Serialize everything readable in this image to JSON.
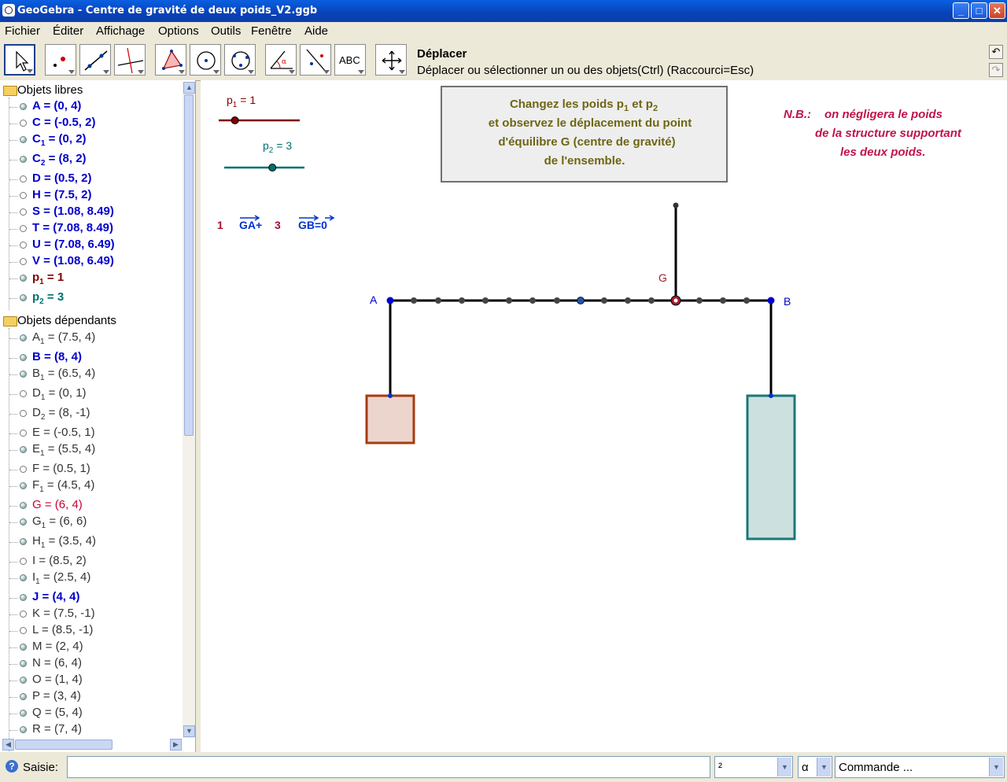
{
  "window": {
    "title": "GeoGebra - Centre de gravité de deux poids_V2.ggb",
    "min": "_",
    "max": "□",
    "close": "✕"
  },
  "menu": [
    "Fichier",
    "Éditer",
    "Affichage",
    "Options",
    "Outils",
    "Fenêtre",
    "Aide"
  ],
  "toolbar": {
    "tool_title": "Déplacer",
    "tool_help": "Déplacer ou sélectionner un ou des objets(Ctrl) (Raccourci=Esc)",
    "text_tool_label": "ABC",
    "undo": "↶",
    "redo": "↷"
  },
  "algebra": {
    "free_header": "Objets libres",
    "dependent_header": "Objets dépendants",
    "free": [
      {
        "name": "A",
        "value": "(0, 4)",
        "shown": true,
        "color": "#0000cc",
        "bold": true
      },
      {
        "name": "C",
        "value": "(-0.5, 2)",
        "shown": false,
        "color": "#0000cc",
        "bold": true
      },
      {
        "name": "C",
        "sub": "1",
        "value": "(0, 2)",
        "shown": true,
        "color": "#0000cc",
        "bold": true
      },
      {
        "name": "C",
        "sub": "2",
        "value": "(8, 2)",
        "shown": true,
        "color": "#0000cc",
        "bold": true
      },
      {
        "name": "D",
        "value": "(0.5, 2)",
        "shown": false,
        "color": "#0000cc",
        "bold": true
      },
      {
        "name": "H",
        "value": "(7.5, 2)",
        "shown": false,
        "color": "#0000cc",
        "bold": true
      },
      {
        "name": "S",
        "value": "(1.08, 8.49)",
        "shown": false,
        "color": "#0000cc",
        "bold": true
      },
      {
        "name": "T",
        "value": "(7.08, 8.49)",
        "shown": false,
        "color": "#0000cc",
        "bold": true
      },
      {
        "name": "U",
        "value": "(7.08, 6.49)",
        "shown": false,
        "color": "#0000cc",
        "bold": true
      },
      {
        "name": "V",
        "value": "(1.08, 6.49)",
        "shown": false,
        "color": "#0000cc",
        "bold": true
      },
      {
        "name": "p",
        "sub": "1",
        "value": "1",
        "shown": true,
        "color": "#800000",
        "bold": true
      },
      {
        "name": "p",
        "sub": "2",
        "value": "3",
        "shown": true,
        "color": "#007070",
        "bold": true
      }
    ],
    "dependent": [
      {
        "name": "A",
        "sub": "1",
        "value": "(7.5, 4)",
        "shown": true,
        "color": "#333333",
        "bold": false
      },
      {
        "name": "B",
        "value": "(8, 4)",
        "shown": true,
        "color": "#0000cc",
        "bold": true
      },
      {
        "name": "B",
        "sub": "1",
        "value": "(6.5, 4)",
        "shown": true,
        "color": "#333333",
        "bold": false
      },
      {
        "name": "D",
        "sub": "1",
        "value": "(0, 1)",
        "shown": false,
        "color": "#333333",
        "bold": false
      },
      {
        "name": "D",
        "sub": "2",
        "value": "(8, -1)",
        "shown": false,
        "color": "#333333",
        "bold": false
      },
      {
        "name": "E",
        "value": "(-0.5, 1)",
        "shown": false,
        "color": "#333333",
        "bold": false
      },
      {
        "name": "E",
        "sub": "1",
        "value": "(5.5, 4)",
        "shown": true,
        "color": "#333333",
        "bold": false
      },
      {
        "name": "F",
        "value": "(0.5, 1)",
        "shown": false,
        "color": "#333333",
        "bold": false
      },
      {
        "name": "F",
        "sub": "1",
        "value": "(4.5, 4)",
        "shown": true,
        "color": "#333333",
        "bold": false
      },
      {
        "name": "G",
        "value": "(6, 4)",
        "shown": true,
        "color": "#cc0033",
        "bold": false
      },
      {
        "name": "G",
        "sub": "1",
        "value": "(6, 6)",
        "shown": true,
        "color": "#333333",
        "bold": false
      },
      {
        "name": "H",
        "sub": "1",
        "value": "(3.5, 4)",
        "shown": true,
        "color": "#333333",
        "bold": false
      },
      {
        "name": "I",
        "value": "(8.5, 2)",
        "shown": false,
        "color": "#333333",
        "bold": false
      },
      {
        "name": "I",
        "sub": "1",
        "value": "(2.5, 4)",
        "shown": true,
        "color": "#333333",
        "bold": false
      },
      {
        "name": "J",
        "value": "(4, 4)",
        "shown": true,
        "color": "#0000cc",
        "bold": true
      },
      {
        "name": "K",
        "value": "(7.5, -1)",
        "shown": false,
        "color": "#333333",
        "bold": false
      },
      {
        "name": "L",
        "value": "(8.5, -1)",
        "shown": false,
        "color": "#333333",
        "bold": false
      },
      {
        "name": "M",
        "value": "(2, 4)",
        "shown": true,
        "color": "#333333",
        "bold": false
      },
      {
        "name": "N",
        "value": "(6, 4)",
        "shown": true,
        "color": "#333333",
        "bold": false
      },
      {
        "name": "O",
        "value": "(1, 4)",
        "shown": true,
        "color": "#333333",
        "bold": false
      },
      {
        "name": "P",
        "value": "(3, 4)",
        "shown": true,
        "color": "#333333",
        "bold": false
      },
      {
        "name": "Q",
        "value": "(5, 4)",
        "shown": true,
        "color": "#333333",
        "bold": false
      },
      {
        "name": "R",
        "value": "(7, 4)",
        "shown": true,
        "color": "#333333",
        "bold": false
      }
    ]
  },
  "graphics": {
    "slider1": {
      "name": "p",
      "sub": "1",
      "value": "1",
      "color": "#800000",
      "fraction": 0.2
    },
    "slider2": {
      "name": "p",
      "sub": "2",
      "value": "3",
      "color": "#007070",
      "fraction": 0.6
    },
    "formula": {
      "c1": "1",
      "v1": "GA",
      "plus": "+",
      "c2": "3",
      "v2": "GB",
      "eq": "=0"
    },
    "instructions": {
      "line1_a": "Changez les poids p",
      "line1_s1": "1",
      "line1_b": " et p",
      "line1_s2": "2",
      "line2": "et observez le déplacement du point",
      "line3": "d'équilibre G (centre de gravité)",
      "line4": "de l'ensemble."
    },
    "nb": {
      "prefix": "N.B.:",
      "line1": "on négligera le poids",
      "line2": "de la structure supportant",
      "line3": "les deux poids."
    },
    "labels": {
      "A": "A",
      "B": "B",
      "G": "G"
    },
    "colors": {
      "beam": "#000000",
      "weight1_fill": "#ecd5cd",
      "weight1_stroke": "#a63c10",
      "weight2_fill": "#cde0e0",
      "weight2_stroke": "#1a7878",
      "text_olive": "#6e6614",
      "nb": "#c0144a",
      "blue": "#0033cc"
    }
  },
  "input": {
    "label": "Saisie:",
    "value": "",
    "combo_power": "²",
    "combo_greek": "α",
    "combo_command": "Commande ..."
  }
}
